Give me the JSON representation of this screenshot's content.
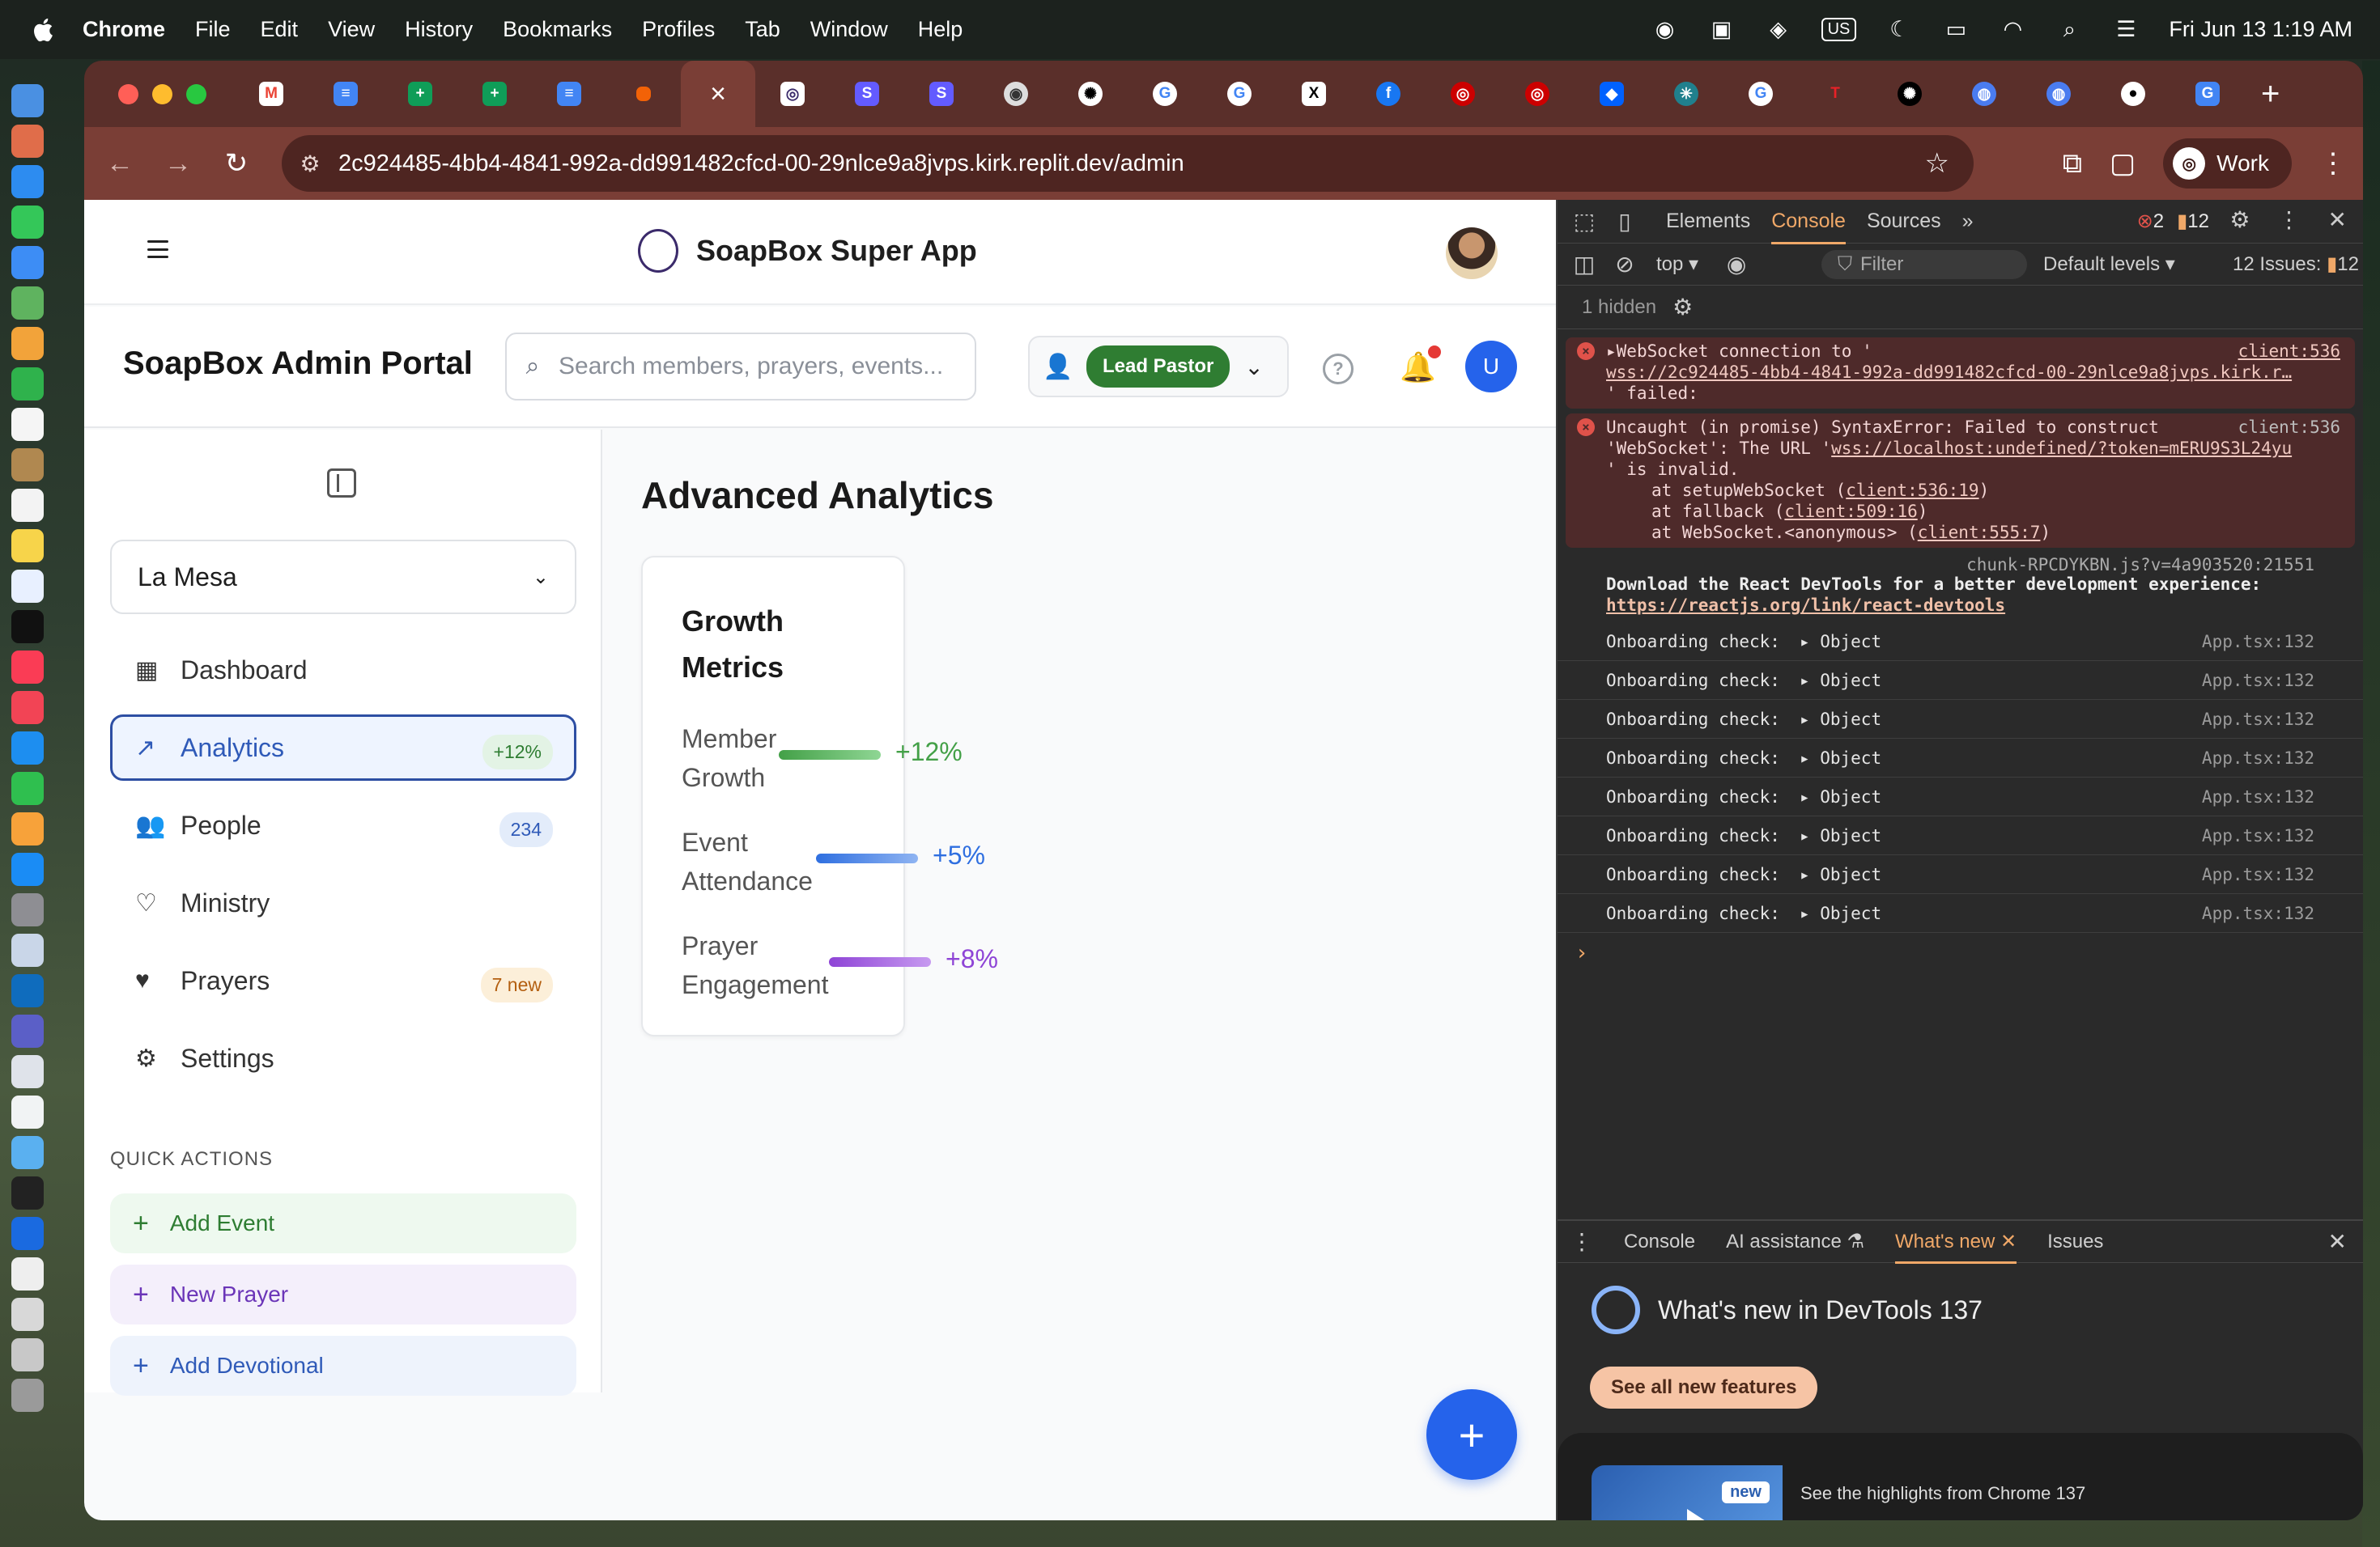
{
  "menubar": {
    "app": "Chrome",
    "menus": [
      "File",
      "Edit",
      "View",
      "History",
      "Bookmarks",
      "Profiles",
      "Tab",
      "Window",
      "Help"
    ],
    "keyboard": "US",
    "datetime": "Fri Jun 13  1:19 AM"
  },
  "browser": {
    "url": "2c924485-4bb4-4841-992a-dd991482cfcd-00-29nlce9a8jvps.kirk.replit.dev/admin",
    "profile": "Work",
    "tab_favicons": [
      "gmail-icon",
      "docs-icon",
      "sheets-icon",
      "sheets-icon",
      "docs-icon",
      "replit-icon",
      "soapbox-icon",
      "stripe-icon",
      "stripe-icon",
      "chrome-icon",
      "openai-icon",
      "google-icon",
      "google-icon",
      "x-icon",
      "facebook-icon",
      "target-icon",
      "target-icon",
      "dropbox-icon",
      "perplexity-icon",
      "google-icon",
      "tesla-icon",
      "openai-icon",
      "globe-icon",
      "globe-icon",
      "github-icon",
      "google-workspace-icon"
    ]
  },
  "app": {
    "name": "SoapBox Super App",
    "portal_title": "SoapBox Admin Portal",
    "search_placeholder": "Search members, prayers, events...",
    "role": "Lead Pastor",
    "user_initial": "U",
    "location": "La Mesa",
    "nav": [
      {
        "label": "Dashboard",
        "icon": "building-icon",
        "badge": ""
      },
      {
        "label": "Analytics",
        "icon": "trending-up-icon",
        "badge": "+12%"
      },
      {
        "label": "People",
        "icon": "users-icon",
        "badge": "234"
      },
      {
        "label": "Ministry",
        "icon": "heart-icon",
        "badge": ""
      },
      {
        "label": "Prayers",
        "icon": "hand-heart-icon",
        "badge": "7 new"
      },
      {
        "label": "Settings",
        "icon": "gear-icon",
        "badge": ""
      }
    ],
    "quick_actions_title": "QUICK ACTIONS",
    "quick_actions": [
      "Add Event",
      "New Prayer",
      "Add Devotional"
    ],
    "main_title": "Advanced Analytics",
    "card_title": "Growth Metrics",
    "metrics": [
      {
        "label_1": "Member",
        "label_2": "Growth",
        "value": "+12%",
        "color": "#43a047"
      },
      {
        "label_1": "Event",
        "label_2": "Attendance",
        "value": "+5%",
        "color": "#2f6fe0"
      },
      {
        "label_1": "Prayer",
        "label_2": "Engagement",
        "value": "+8%",
        "color": "#8e44d6"
      }
    ]
  },
  "devtools": {
    "tabs": [
      "Elements",
      "Console",
      "Sources"
    ],
    "active_tab": "Console",
    "error_count": "2",
    "warning_count": "12",
    "context": "top",
    "filter_placeholder": "Filter",
    "levels": "Default levels",
    "issues": "12 Issues:",
    "issues_count": "12",
    "hidden": "1 hidden",
    "err1_line1": "WebSocket connection to '",
    "err1_link": "wss://2c924485-4bb4-4841-992a-dd991482cfcd-00-29nlce9a8jvps.kirk.r…",
    "err1_line3": "' failed:",
    "err1_src": "client:536",
    "err2_line1": "Uncaught (in promise) SyntaxError: Failed to construct",
    "err2_line2a": "'WebSocket': The URL '",
    "err2_link": "wss://localhost:undefined/?token=mERU9S3L24yu",
    "err2_line3": "' is invalid.",
    "err2_at1a": "at setupWebSocket (",
    "err2_at1b": "client:536:19",
    "err2_at2a": "at fallback (",
    "err2_at2b": "client:509:16",
    "err2_at3a": "at WebSocket.<anonymous> (",
    "err2_at3b": "client:555:7",
    "err2_src": "client:536",
    "rdt_src": "chunk-RPCDYKBN.js?v=4a903520:21551",
    "rdt_text": "Download the React DevTools for a better development experience:",
    "rdt_link": "https://reactjs.org/link/react-devtools",
    "log_rows": [
      {
        "msg": "Onboarding check:",
        "obj": "Object",
        "src": "App.tsx:132"
      },
      {
        "msg": "Onboarding check:",
        "obj": "Object",
        "src": "App.tsx:132"
      },
      {
        "msg": "Onboarding check:",
        "obj": "Object",
        "src": "App.tsx:132"
      },
      {
        "msg": "Onboarding check:",
        "obj": "Object",
        "src": "App.tsx:132"
      },
      {
        "msg": "Onboarding check:",
        "obj": "Object",
        "src": "App.tsx:132"
      },
      {
        "msg": "Onboarding check:",
        "obj": "Object",
        "src": "App.tsx:132"
      },
      {
        "msg": "Onboarding check:",
        "obj": "Object",
        "src": "App.tsx:132"
      },
      {
        "msg": "Onboarding check:",
        "obj": "Object",
        "src": "App.tsx:132"
      }
    ],
    "drawer_tabs": [
      "Console",
      "AI assistance",
      "What's new",
      "Issues"
    ],
    "whats_new_title": "What's new in DevTools 137",
    "whats_new_button": "See all new features",
    "whats_new_badge": "new",
    "whats_new_card": "See the highlights from Chrome 137"
  }
}
